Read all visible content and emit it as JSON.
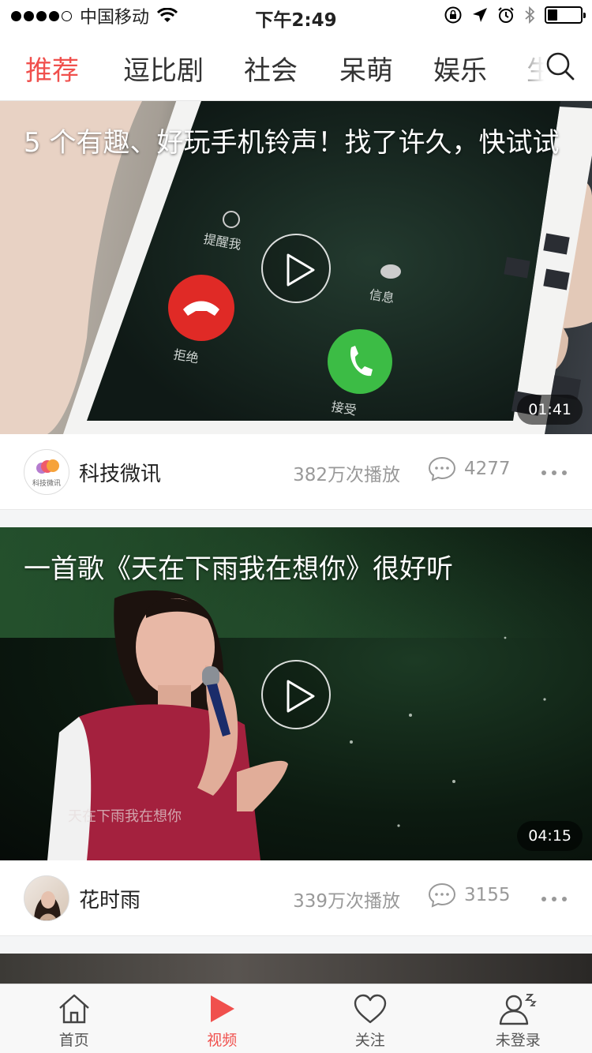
{
  "status_bar": {
    "carrier": "中国移动",
    "time": "下午2:49"
  },
  "tabs": [
    {
      "label": "推荐",
      "active": true
    },
    {
      "label": "逗比剧",
      "active": false
    },
    {
      "label": "社会",
      "active": false
    },
    {
      "label": "呆萌",
      "active": false
    },
    {
      "label": "娱乐",
      "active": false
    },
    {
      "label": "生",
      "active": false
    }
  ],
  "videos": [
    {
      "title": "5 个有趣、好玩手机铃声！找了许久，快试试",
      "duration": "01:41",
      "author": "科技微讯",
      "avatar_text": "科技微讯",
      "plays": "382万次播放",
      "comments": "4277",
      "scene_labels": {
        "remind": "提醒我",
        "message": "信息",
        "decline": "拒绝",
        "accept": "接受"
      }
    },
    {
      "title": "一首歌《天在下雨我在想你》很好听",
      "duration": "04:15",
      "author": "花时雨",
      "plays": "339万次播放",
      "comments": "3155",
      "subtitle_text": "天在下雨我在想你"
    }
  ],
  "tabbar": [
    {
      "label": "首页",
      "icon": "home-icon",
      "active": false
    },
    {
      "label": "视频",
      "icon": "video-play-icon",
      "active": true
    },
    {
      "label": "关注",
      "icon": "heart-icon",
      "active": false
    },
    {
      "label": "未登录",
      "icon": "user-sleep-icon",
      "active": false
    }
  ],
  "colors": {
    "accent": "#f0504d",
    "muted": "#999999"
  }
}
